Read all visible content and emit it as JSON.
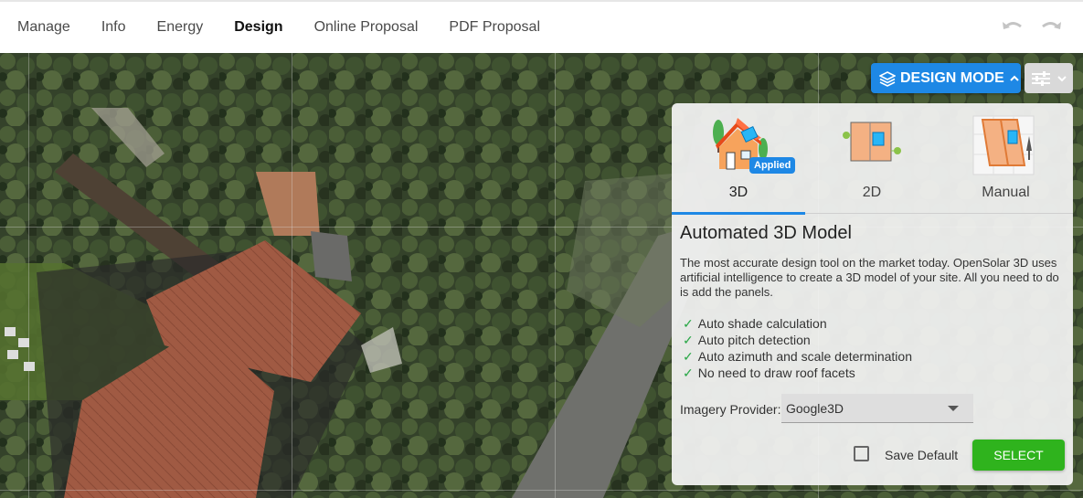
{
  "nav": {
    "items": [
      {
        "label": "Manage",
        "active": false
      },
      {
        "label": "Info",
        "active": false
      },
      {
        "label": "Energy",
        "active": false
      },
      {
        "label": "Design",
        "active": true
      },
      {
        "label": "Online Proposal",
        "active": false
      },
      {
        "label": "PDF Proposal",
        "active": false
      }
    ],
    "undo_icon": "undo-icon",
    "redo_icon": "redo-icon"
  },
  "toolbar": {
    "design_mode_label": "DESIGN MODE",
    "layers_icon": "layers-icon",
    "settings_icon": "sliders-icon"
  },
  "panel": {
    "tabs": [
      {
        "label": "3D",
        "active": true,
        "icon": "house-3d-icon"
      },
      {
        "label": "2D",
        "active": false,
        "icon": "plan-2d-icon"
      },
      {
        "label": "Manual",
        "active": false,
        "icon": "manual-map-icon"
      }
    ],
    "applied_badge": "Applied",
    "title": "Automated 3D Model",
    "description": "The most accurate design tool on the market today. OpenSolar 3D uses artificial intelligence to create a 3D model of your site. All you need to do is add the panels.",
    "features": [
      "Auto shade calculation",
      "Auto pitch detection",
      "Auto azimuth and scale determination",
      "No need to draw roof facets"
    ],
    "check_glyph": "✓",
    "imagery_label": "Imagery Provider:",
    "imagery_value": "Google3D",
    "save_default_label": "Save Default",
    "save_default_checked": false,
    "select_label": "SELECT"
  },
  "colors": {
    "accent": "#1e88e5",
    "select_green": "#2fb31d",
    "check_green": "#28a745"
  }
}
